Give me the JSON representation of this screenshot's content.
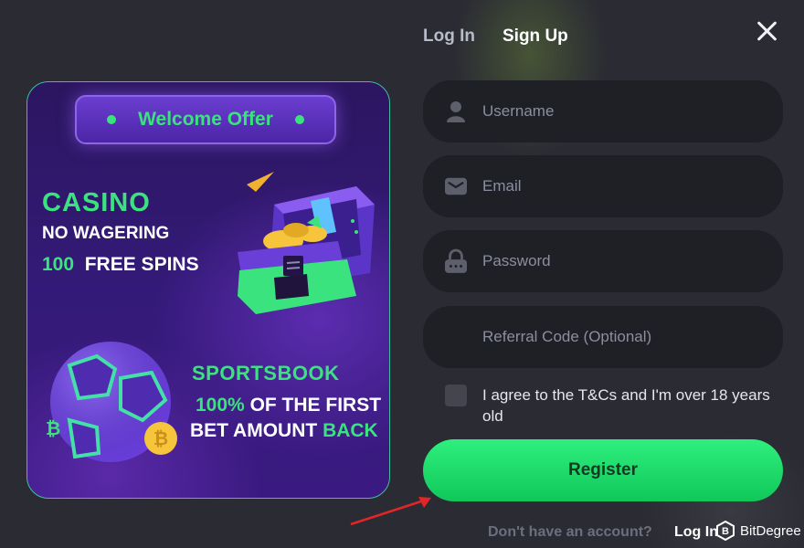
{
  "tabs": {
    "login": "Log In",
    "signup": "Sign Up"
  },
  "promo": {
    "badge": "Welcome Offer",
    "casino": "CASINO",
    "no_wagering": "NO WAGERING",
    "spins_count": "100",
    "spins_label": "FREE SPINS",
    "sportsbook": "SPORTSBOOK",
    "first_pct": "100%",
    "first_rest": "OF THE FIRST",
    "bet_amount": "BET AMOUNT",
    "bet_back": "BACK"
  },
  "form": {
    "username_placeholder": "Username",
    "email_placeholder": "Email",
    "password_placeholder": "Password",
    "referral_placeholder": "Referral Code (Optional)",
    "agree_text": "I agree to the T&Cs and I'm over 18 years old",
    "register_label": "Register",
    "footer_text": "Don't have an account?",
    "footer_link": "Log In"
  },
  "watermark": {
    "text": "BitDegree",
    "logo": "bitdegree-logo"
  },
  "colors": {
    "accent": "#3be37e",
    "field_bg": "#1f1f26",
    "register_btn": "#1ee06c",
    "promo_bg": "#341a78"
  }
}
